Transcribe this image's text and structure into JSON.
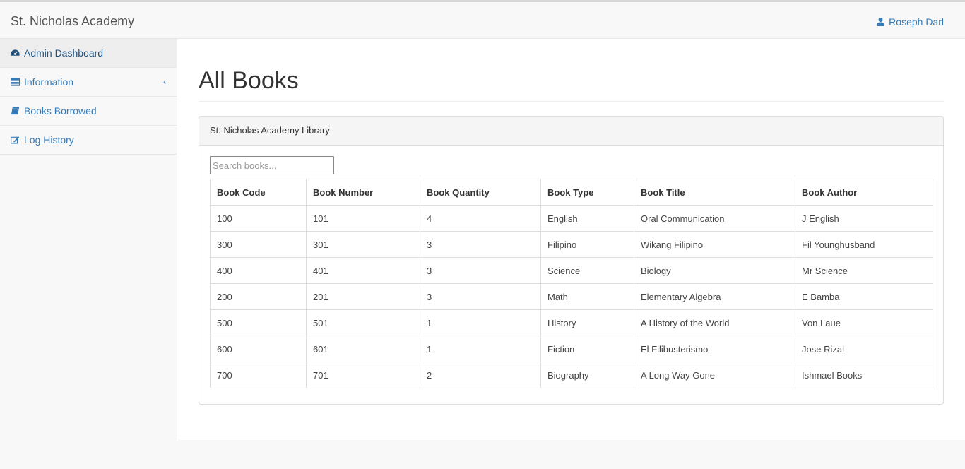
{
  "header": {
    "brand": "St. Nicholas Academy",
    "user_name": "Roseph Darl"
  },
  "sidebar": {
    "items": [
      {
        "label": "Admin Dashboard",
        "icon": "dashboard-icon"
      },
      {
        "label": "Information",
        "icon": "table-icon"
      },
      {
        "label": "Books Borrowed",
        "icon": "book-icon"
      },
      {
        "label": "Log History",
        "icon": "edit-icon"
      }
    ],
    "chevron": "‹"
  },
  "main": {
    "title": "All Books",
    "panel_heading": "St. Nicholas Academy Library",
    "search_placeholder": "Search books...",
    "columns": [
      "Book Code",
      "Book Number",
      "Book Quantity",
      "Book Type",
      "Book Title",
      "Book Author"
    ],
    "rows": [
      [
        "100",
        "101",
        "4",
        "English",
        "Oral Communication",
        "J English"
      ],
      [
        "300",
        "301",
        "3",
        "Filipino",
        "Wikang Filipino",
        "Fil Younghusband"
      ],
      [
        "400",
        "401",
        "3",
        "Science",
        "Biology",
        "Mr Science"
      ],
      [
        "200",
        "201",
        "3",
        "Math",
        "Elementary Algebra",
        "E Bamba"
      ],
      [
        "500",
        "501",
        "1",
        "History",
        "A History of the World",
        "Von Laue"
      ],
      [
        "600",
        "601",
        "1",
        "Fiction",
        "El Filibusterismo",
        "Jose Rizal"
      ],
      [
        "700",
        "701",
        "2",
        "Biography",
        "A Long Way Gone",
        "Ishmael Books"
      ]
    ]
  },
  "colors": {
    "link": "#337ab7",
    "border": "#dddddd",
    "panel_heading_bg": "#f5f5f5"
  }
}
